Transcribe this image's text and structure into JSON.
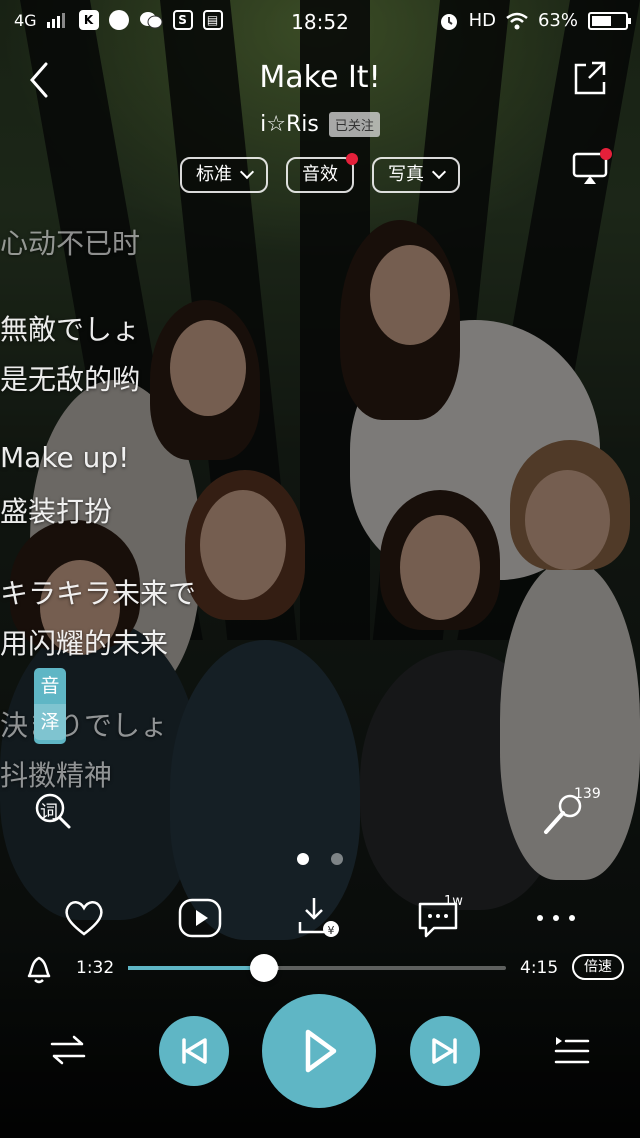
{
  "status_bar": {
    "network": "4G",
    "time": "18:52",
    "hd": "HD",
    "battery": "63%",
    "battery_level": 0.63
  },
  "header": {
    "title": "Make It!",
    "artist": "i☆Ris",
    "follow_label": "已关注"
  },
  "chips": {
    "quality": "标准",
    "effects": "音效",
    "photos": "写真"
  },
  "lyrics": [
    {
      "text": "心动不已时",
      "dim": true
    },
    {
      "text": "無敵でしょ",
      "dim": false
    },
    {
      "text": "是无敌的哟",
      "dim": false
    },
    {
      "text": "Make up!",
      "dim": false
    },
    {
      "text": "盛装打扮",
      "dim": false
    },
    {
      "text": "キラキラ未来で",
      "dim": false
    },
    {
      "text": "用闪耀的未来",
      "dim": false
    },
    {
      "text": "決まりでしょ",
      "dim": true
    },
    {
      "text": "抖擞精神",
      "dim": true
    }
  ],
  "translation_badge": [
    "音",
    "泽"
  ],
  "lyric_search_label": "词",
  "mic_count": "139",
  "comment_count": "1w",
  "page_dots": {
    "count": 2,
    "active": 0
  },
  "player": {
    "current_time": "1:32",
    "total_time": "4:15",
    "progress": 0.36,
    "buffered": 0.4,
    "speed_label": "倍速"
  },
  "colors": {
    "accent": "#5fb6c5",
    "badge_red": "#e5203a"
  },
  "icons": [
    "back-icon",
    "share-icon",
    "cast-icon",
    "lyric-search-icon",
    "microphone-icon",
    "heart-icon",
    "video-icon",
    "download-icon",
    "comment-icon",
    "more-icon",
    "bell-icon",
    "play-mode-icon",
    "previous-icon",
    "play-icon",
    "next-icon",
    "playlist-icon"
  ]
}
